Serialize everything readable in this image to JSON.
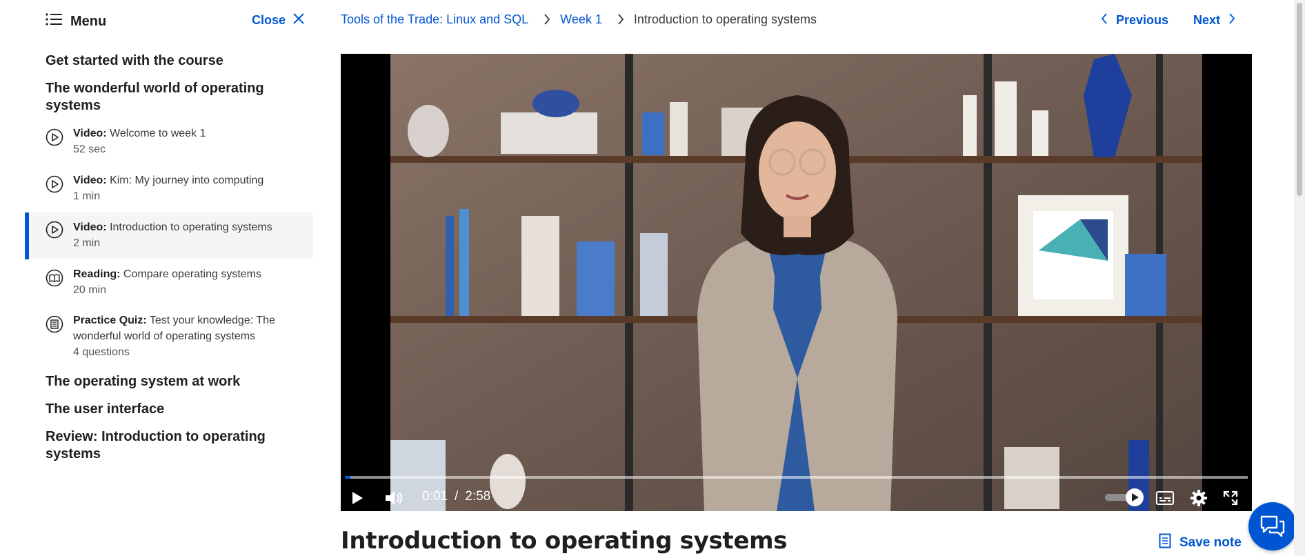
{
  "sidebar": {
    "menu_label": "Menu",
    "close_label": "Close",
    "sections": [
      "Get started with the course",
      "The wonderful world of operating systems"
    ],
    "items": [
      {
        "kind": "Video:",
        "title": "Welcome to week 1",
        "meta": "52 sec",
        "icon": "play-circle-icon",
        "active": false
      },
      {
        "kind": "Video:",
        "title": "Kim: My journey into computing",
        "meta": "1 min",
        "icon": "play-circle-icon",
        "active": false
      },
      {
        "kind": "Video:",
        "title": "Introduction to operating systems",
        "meta": "2 min",
        "icon": "play-circle-icon",
        "active": true
      },
      {
        "kind": "Reading:",
        "title": "Compare operating systems",
        "meta": "20 min",
        "icon": "book-icon",
        "active": false
      },
      {
        "kind": "Practice Quiz:",
        "title": "Test your knowledge: The wonderful world of operating systems",
        "meta": "4 questions",
        "icon": "quiz-icon",
        "active": false
      }
    ],
    "sections_after": [
      "The operating system at work",
      "The user interface",
      "Review: Introduction to operating systems"
    ]
  },
  "breadcrumb": {
    "course": "Tools of the Trade: Linux and SQL",
    "week": "Week 1",
    "current": "Introduction to operating systems"
  },
  "nav": {
    "previous": "Previous",
    "next": "Next"
  },
  "video": {
    "current_time": "0:01",
    "separator": "/",
    "duration": "2:58",
    "progress_fraction": 0.006
  },
  "page_title": "Introduction to operating systems",
  "save_note_label": "Save note",
  "colors": {
    "accent": "#0056d2",
    "active_bg": "#f5f5f5"
  }
}
